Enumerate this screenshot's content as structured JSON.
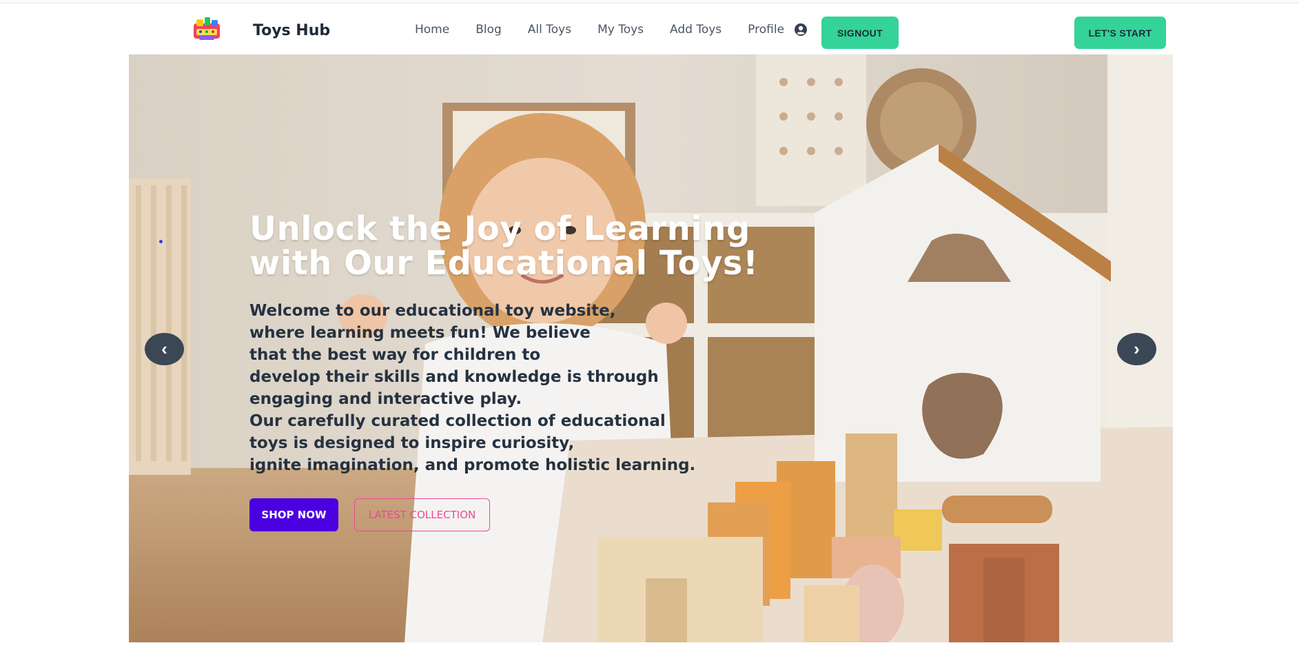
{
  "nav": {
    "brand": "Toys Hub",
    "links": [
      "Home",
      "Blog",
      "All Toys",
      "My Toys",
      "Add Toys",
      "Profile"
    ],
    "signout_label": "SIGNOUT",
    "start_label": "LET'S START",
    "accent_color": "#34d399"
  },
  "hero": {
    "title_line1": "Unlock the Joy of Learning",
    "title_line2": "with Our Educational Toys!",
    "text_lines": [
      "Welcome to our educational toy website,",
      "where learning meets fun! We believe",
      "that the best way for children to",
      "develop their skills and knowledge is through",
      "engaging and interactive play.",
      "Our carefully curated collection of educational",
      "toys is designed to inspire curiosity,",
      "ignite imagination, and promote holistic learning."
    ],
    "shop_label": "SHOP NOW",
    "latest_label": "LATEST COLLECTION",
    "prev_icon": "chevron-left-icon",
    "next_icon": "chevron-right-icon",
    "prev_glyph": "‹",
    "next_glyph": "›"
  }
}
